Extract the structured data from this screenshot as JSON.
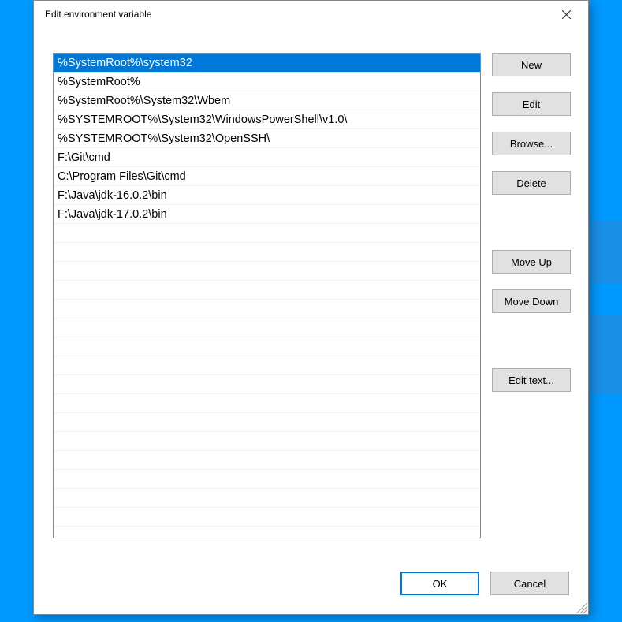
{
  "window": {
    "title": "Edit environment variable"
  },
  "list": {
    "selectedIndex": 0,
    "items": [
      "%SystemRoot%\\system32",
      "%SystemRoot%",
      "%SystemRoot%\\System32\\Wbem",
      "%SYSTEMROOT%\\System32\\WindowsPowerShell\\v1.0\\",
      "%SYSTEMROOT%\\System32\\OpenSSH\\",
      "F:\\Git\\cmd",
      "C:\\Program Files\\Git\\cmd",
      "F:\\Java\\jdk-16.0.2\\bin",
      "F:\\Java\\jdk-17.0.2\\bin"
    ]
  },
  "buttons": {
    "new": "New",
    "edit": "Edit",
    "browse": "Browse...",
    "delete": "Delete",
    "moveUp": "Move Up",
    "moveDown": "Move Down",
    "editText": "Edit text...",
    "ok": "OK",
    "cancel": "Cancel"
  }
}
